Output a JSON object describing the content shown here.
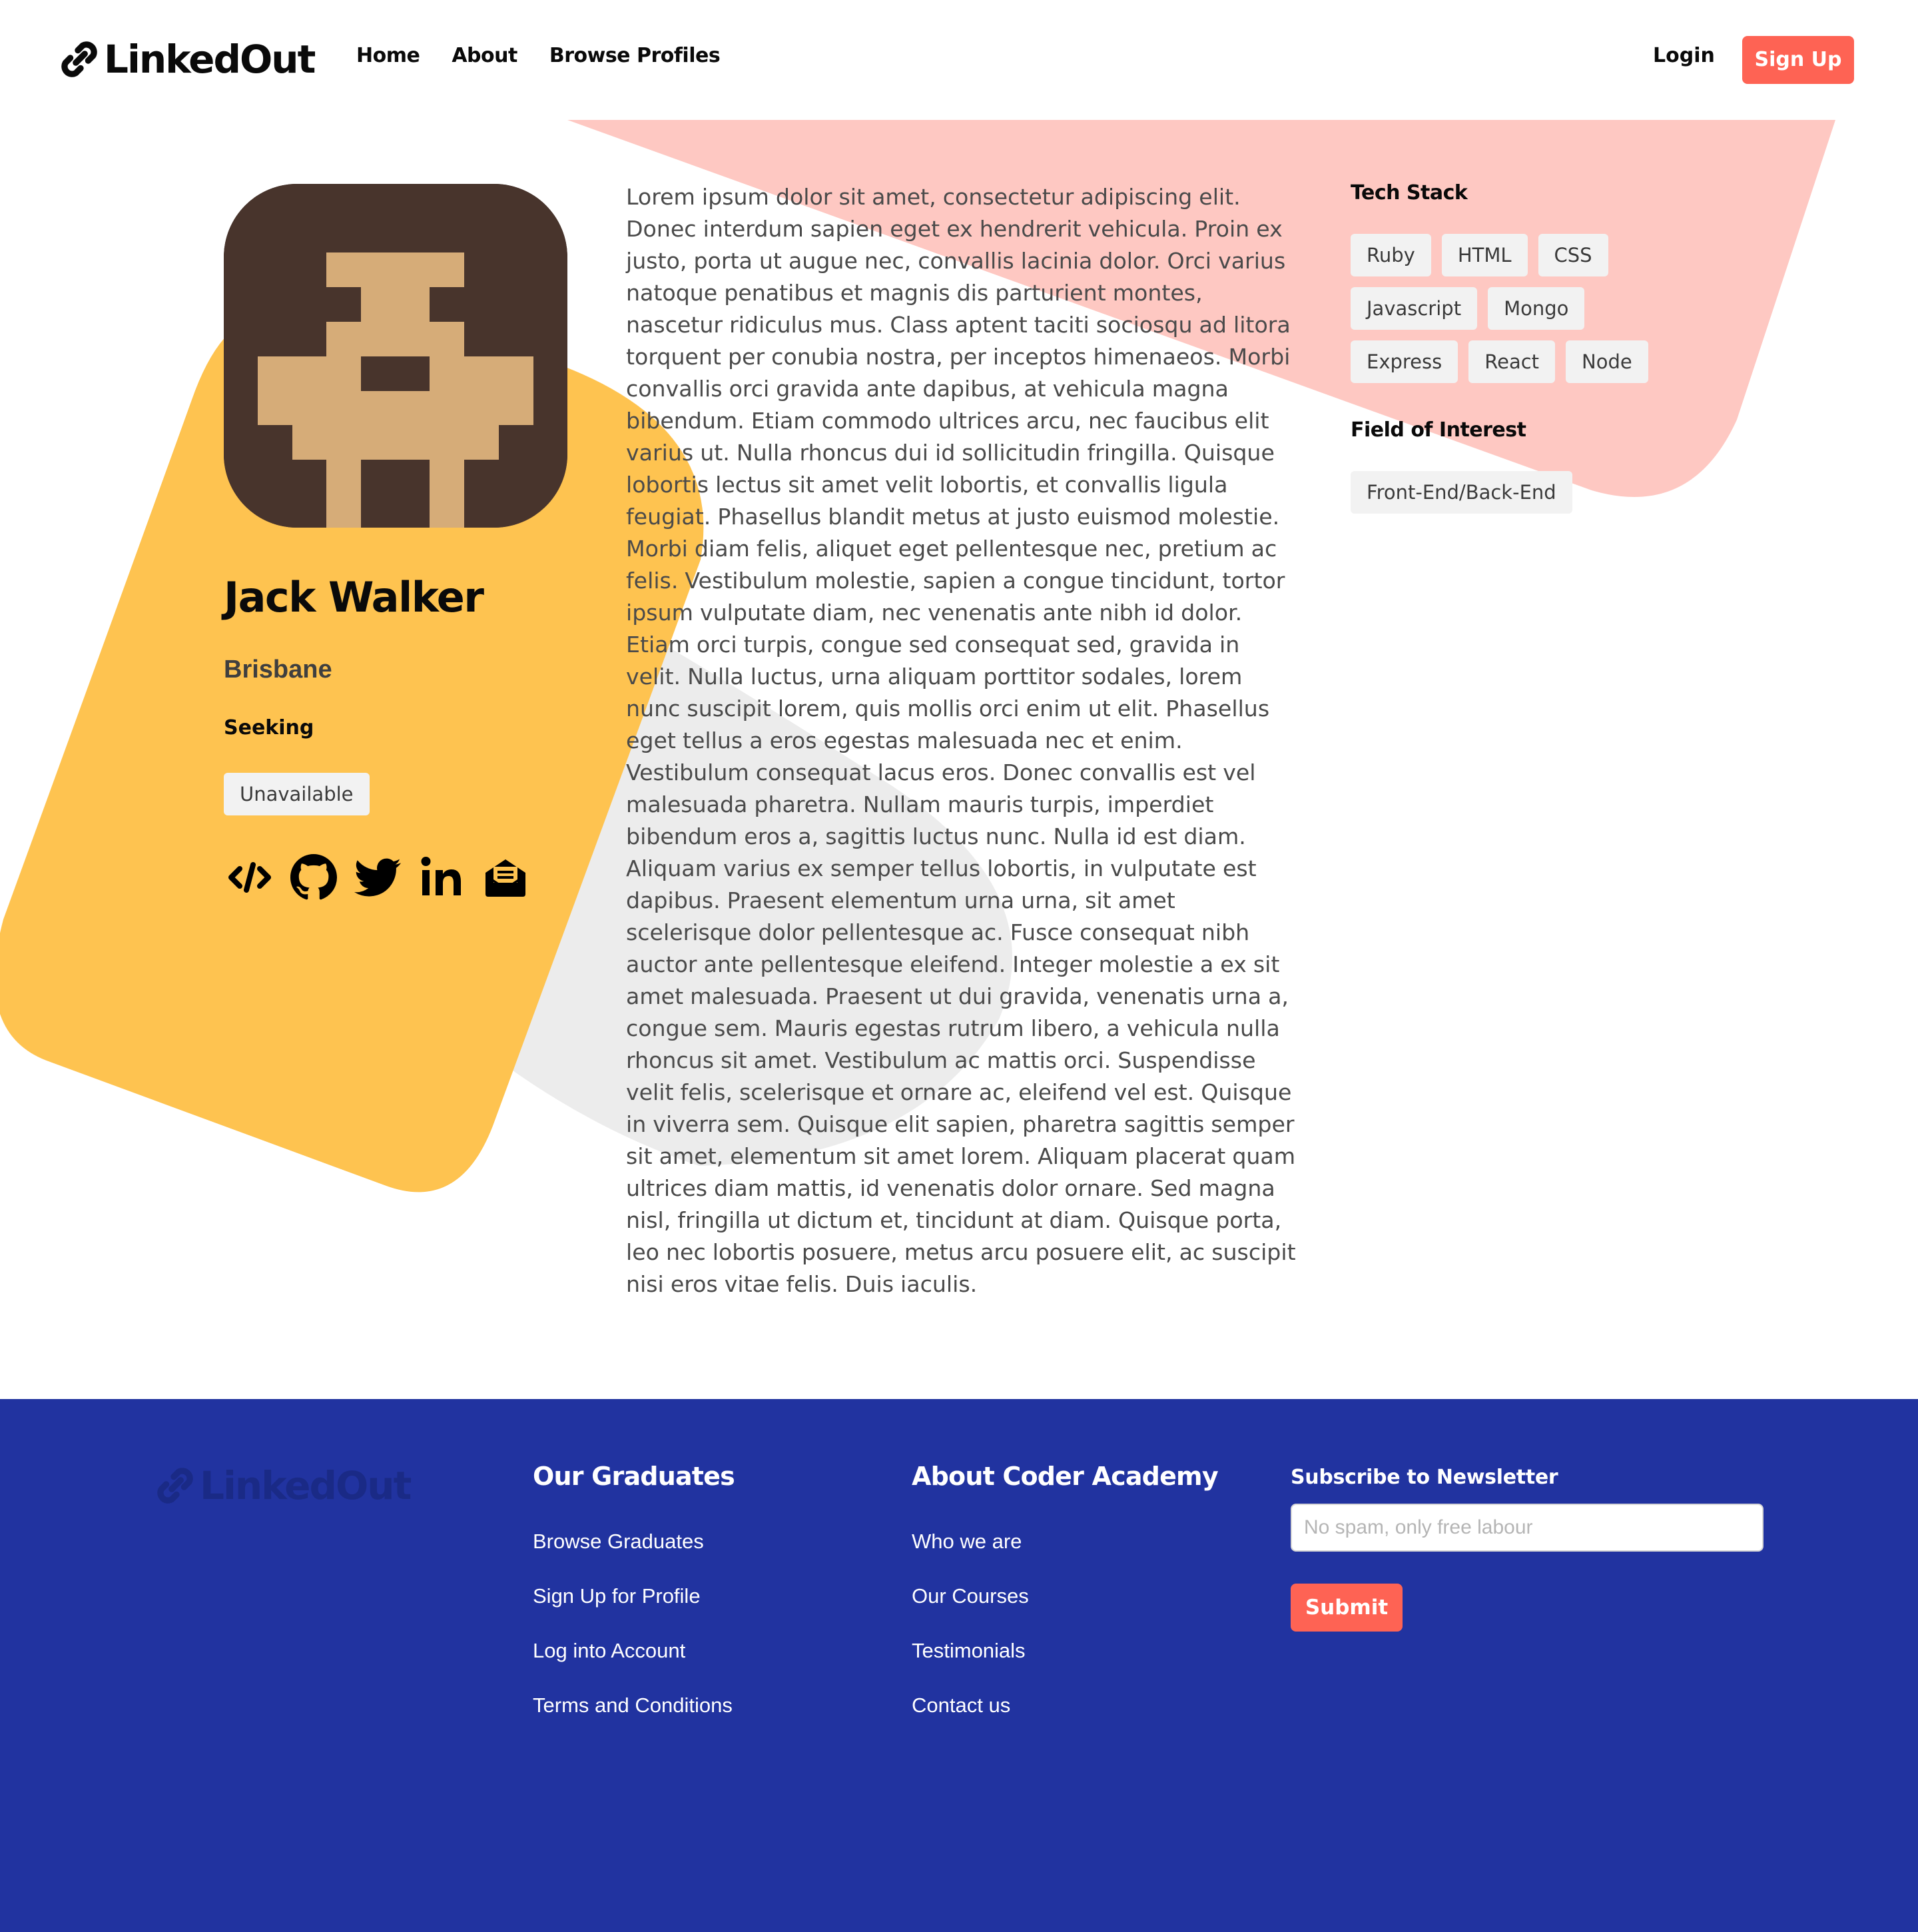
{
  "nav": {
    "brand": "LinkedOut",
    "links": [
      "Home",
      "About",
      "Browse Profiles"
    ],
    "login": "Login",
    "signup": "Sign Up"
  },
  "colors": {
    "accent": "#fe6354",
    "yellow": "#fec350",
    "pink": "#fec8c2",
    "footer": "#2133a0",
    "avatar_hair": "#48342c",
    "avatar_skin": "#d6ac78"
  },
  "profile": {
    "name": "Jack Walker",
    "city": "Brisbane",
    "seeking_label": "Seeking",
    "status": "Unavailable",
    "social_icons": [
      "code-icon",
      "github-icon",
      "twitter-icon",
      "linkedin-icon",
      "email-icon"
    ]
  },
  "bio": "Lorem ipsum dolor sit amet, consectetur adipiscing elit. Donec interdum sapien eget ex hendrerit vehicula. Proin ex justo, porta ut augue nec, convallis lacinia dolor. Orci varius natoque penatibus et magnis dis parturient montes, nascetur ridiculus mus. Class aptent taciti sociosqu ad litora torquent per conubia nostra, per inceptos himenaeos. Morbi convallis orci gravida ante dapibus, at vehicula magna bibendum. Etiam commodo ultrices arcu, nec faucibus elit varius ut. Nulla rhoncus dui id sollicitudin fringilla. Quisque lobortis lectus sit amet velit lobortis, et convallis ligula feugiat. Phasellus blandit metus at justo euismod molestie. Morbi diam felis, aliquet eget pellentesque nec, pretium ac felis. Vestibulum molestie, sapien a congue tincidunt, tortor ipsum vulputate diam, nec venenatis ante nibh id dolor. Etiam orci turpis, congue sed consequat sed, gravida in velit. Nulla luctus, urna aliquam porttitor sodales, lorem nunc suscipit lorem, quis mollis orci enim ut elit. Phasellus eget tellus a eros egestas malesuada nec et enim. Vestibulum consequat lacus eros. Donec convallis est vel malesuada pharetra. Nullam mauris turpis, imperdiet bibendum eros a, sagittis luctus nunc. Nulla id est diam. Aliquam varius ex semper tellus lobortis, in vulputate est dapibus. Praesent elementum urna urna, sit amet scelerisque dolor pellentesque ac. Fusce consequat nibh auctor ante pellentesque eleifend. Integer molestie a ex sit amet malesuada. Praesent ut dui gravida, venenatis urna a, congue sem. Mauris egestas rutrum libero, a vehicula nulla rhoncus sit amet. Vestibulum ac mattis orci. Suspendisse velit felis, scelerisque et ornare ac, eleifend vel est. Quisque in viverra sem. Quisque elit sapien, pharetra sagittis semper sit amet, elementum sit amet lorem. Aliquam placerat quam ultrices diam mattis, id venenatis dolor ornare. Sed magna nisl, fringilla ut dictum et, tincidunt at diam. Quisque porta, leo nec lobortis posuere, metus arcu posuere elit, ac suscipit nisi eros vitae felis. Duis iaculis.",
  "sidebar": {
    "tech_heading": "Tech Stack",
    "tech": [
      "Ruby",
      "HTML",
      "CSS",
      "Javascript",
      "Mongo",
      "Express",
      "React",
      "Node"
    ],
    "field_heading": "Field of Interest",
    "fields": [
      "Front-End/Back-End"
    ]
  },
  "footer": {
    "brand": "LinkedOut",
    "graduates": {
      "heading": "Our Graduates",
      "links": [
        "Browse Graduates",
        "Sign Up for Profile",
        "Log into Account",
        "Terms and Conditions"
      ]
    },
    "about": {
      "heading": "About Coder Academy",
      "links": [
        "Who we are",
        "Our Courses",
        "Testimonials",
        "Contact us"
      ]
    },
    "newsletter": {
      "heading": "Subscribe to Newsletter",
      "placeholder": "No spam, only free labour",
      "value": "",
      "submit": "Submit"
    }
  }
}
